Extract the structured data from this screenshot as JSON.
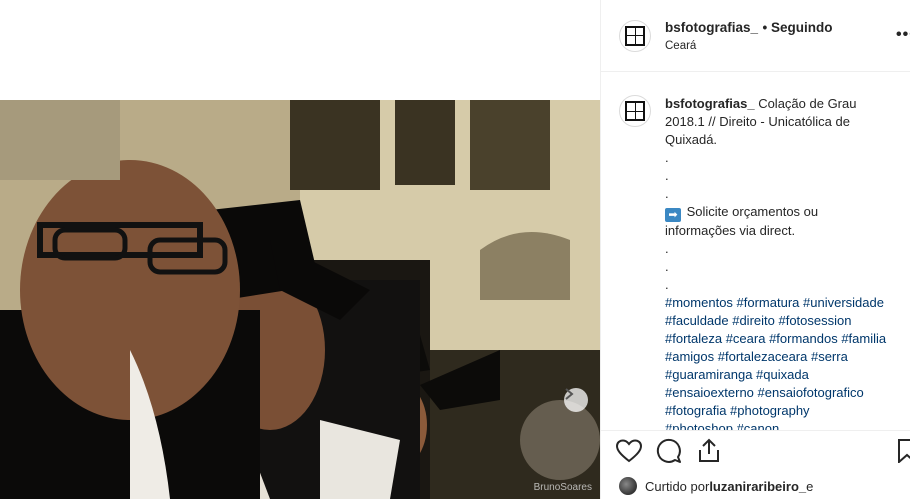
{
  "post": {
    "username": "bsfotografias_",
    "follow_status": "• Seguindo",
    "location": "Ceará",
    "more_icon": "more-horizontal-icon",
    "photo_watermark": "BrunoSoares"
  },
  "caption": {
    "username": "bsfotografias_",
    "text_line1": " Colação de Grau",
    "text_line2": "2018.1 // Direito - Unicatólica de",
    "text_line3": "Quixadá.",
    "dot": ".",
    "cta_icon": "➡",
    "cta_line1": " Solicite orçamentos ou",
    "cta_line2": "informações via direct.",
    "hashtag_lines": [
      "#momentos #formatura #universidade",
      "#faculdade #direito #fotosession",
      "#fortaleza #ceara #formandos #familia",
      "#amigos #fortalezaceara #serra",
      "#guaramiranga #quixada",
      "#ensaioexterno #ensaiofotografico",
      "#fotografia #photography",
      "#photoshop #canon"
    ]
  },
  "likes": {
    "prefix": "Curtido por ",
    "user": "luzaniraribeiro_",
    "suffix": " e"
  },
  "colors": {
    "text": "#262626",
    "hashtag": "#00376b",
    "border": "#efefef"
  }
}
